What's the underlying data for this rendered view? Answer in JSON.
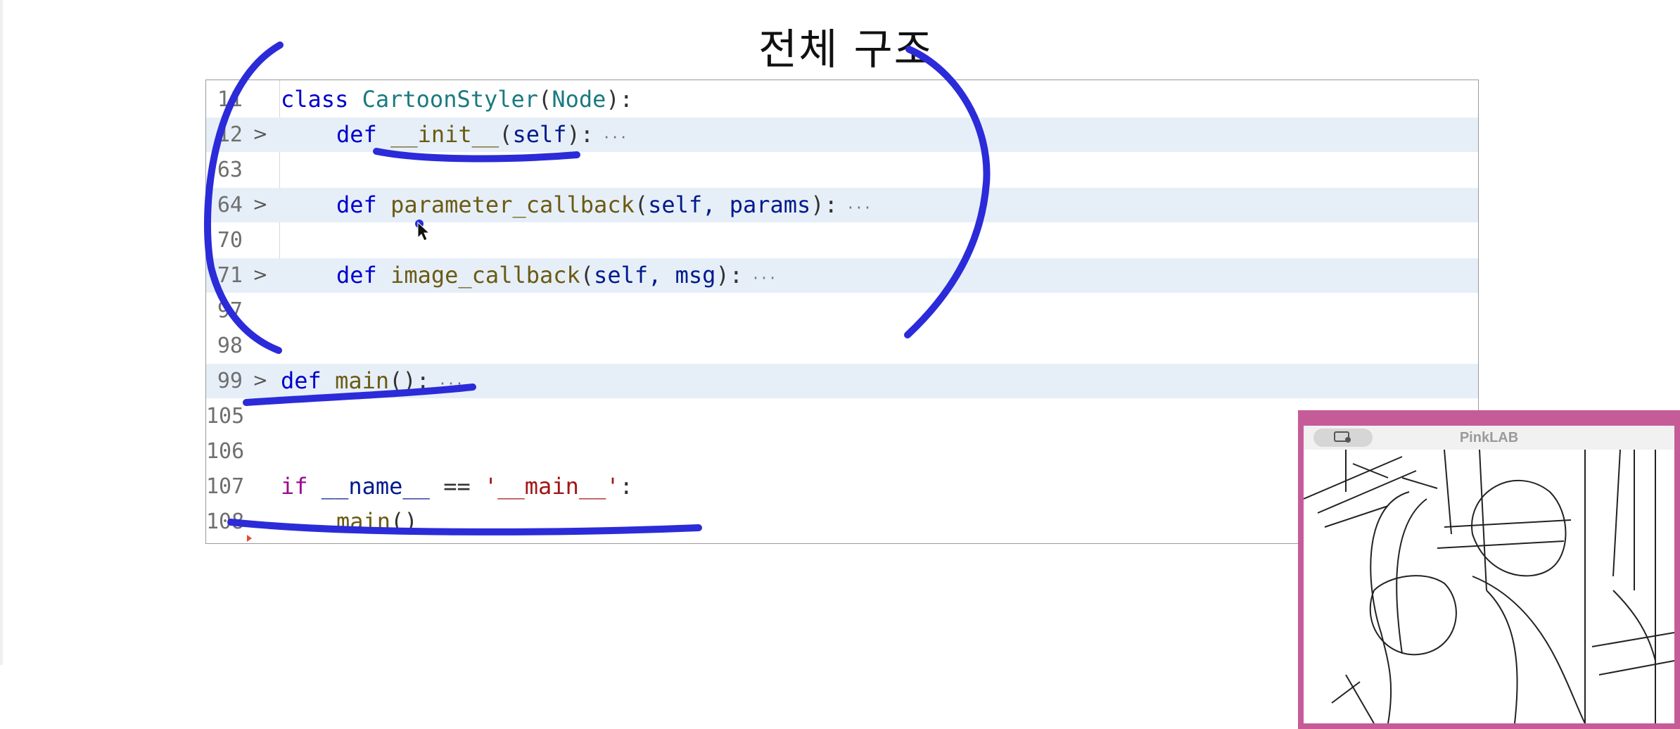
{
  "slide": {
    "title": "전체 구조"
  },
  "editor": {
    "lines": [
      {
        "num": "11",
        "tokens": [
          "class",
          " ",
          "CartoonStyler",
          "(",
          "Node",
          "):"
        ]
      },
      {
        "num": "12",
        "tokens": [
          "def",
          " ",
          "__init__",
          "(",
          "self",
          "):",
          " ···"
        ]
      },
      {
        "num": "63"
      },
      {
        "num": "64",
        "tokens": [
          "def",
          " ",
          "parameter_callback",
          "(",
          "self, params",
          "):",
          " ···"
        ]
      },
      {
        "num": "70"
      },
      {
        "num": "71",
        "tokens": [
          "def",
          " ",
          "image_callback",
          "(",
          "self, msg",
          "):",
          " ···"
        ]
      },
      {
        "num": "97"
      },
      {
        "num": "98"
      },
      {
        "num": "99",
        "tokens": [
          "def",
          " ",
          "main",
          "():",
          " ···"
        ]
      },
      {
        "num": "105"
      },
      {
        "num": "106"
      },
      {
        "num": "107",
        "tokens": [
          "if",
          " ",
          "__name__",
          " == ",
          "'__main__'",
          ":"
        ]
      },
      {
        "num": "108",
        "tokens": [
          "main",
          "()"
        ]
      }
    ],
    "fold_marker": ">"
  },
  "pip": {
    "title": "PinkLAB",
    "icon": "screen-share-icon"
  },
  "colors": {
    "annotation": "#2b2bd9",
    "pip_border": "#c65c97",
    "folded_row": "#e6eff8"
  }
}
